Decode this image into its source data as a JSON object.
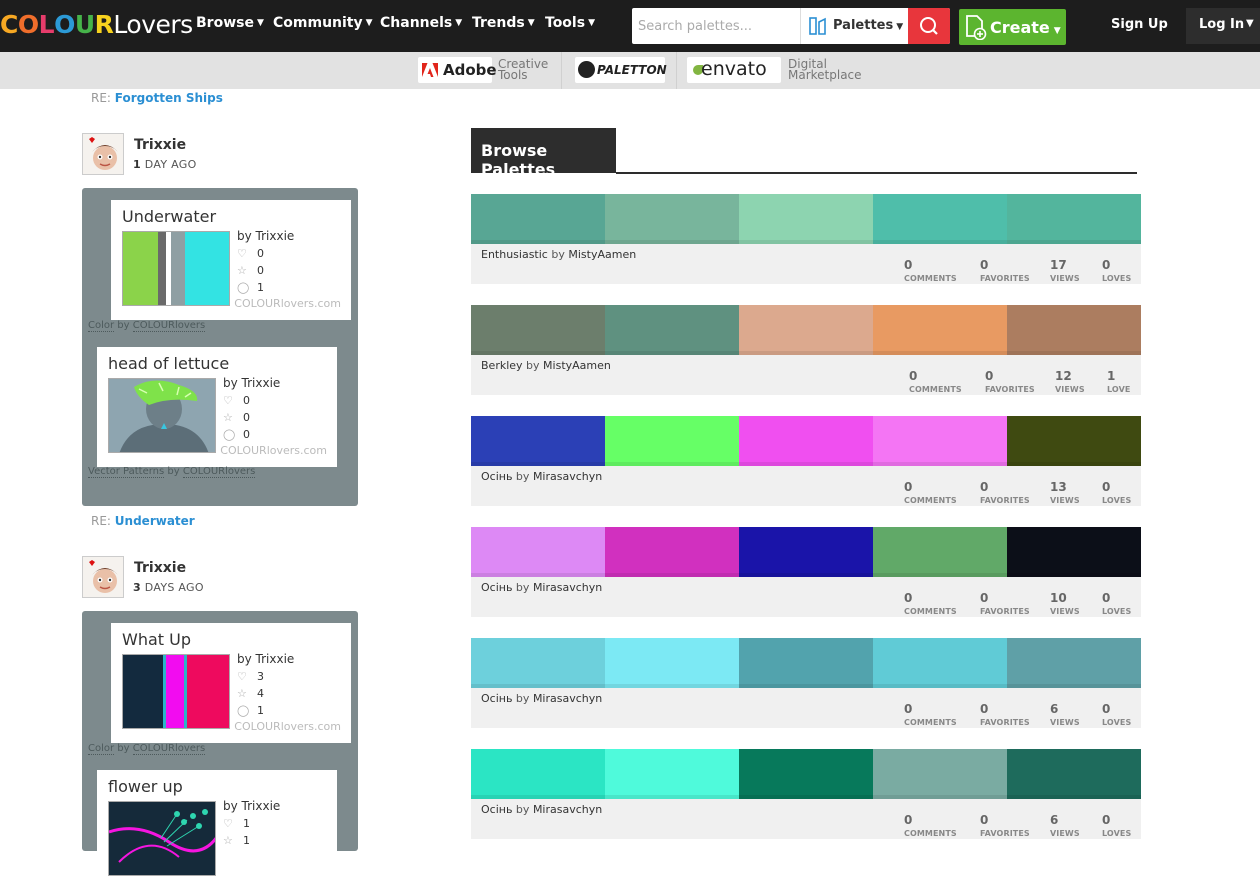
{
  "brand": {
    "letters": [
      "C",
      "O",
      "L",
      "O",
      "U",
      "R"
    ],
    "letter_colors": [
      "#f7a823",
      "#f06e2b",
      "#e73c6b",
      "#2c9ad6",
      "#46b34a",
      "#f7d21e"
    ],
    "rest": "Lovers"
  },
  "nav": [
    "Browse",
    "Community",
    "Channels",
    "Trends",
    "Tools"
  ],
  "search": {
    "placeholder": "Search palettes...",
    "type_label": "Palettes"
  },
  "create_label": "Create",
  "signup_label": "Sign Up",
  "login_label": "Log In",
  "sponsors": [
    {
      "name": "Adobe",
      "caption": [
        "Creative",
        "Tools"
      ]
    },
    {
      "name": "PALETTON",
      "caption": []
    },
    {
      "name": "envato",
      "caption": [
        "Digital",
        "Marketplace"
      ]
    }
  ],
  "feed": {
    "re_prefix": "RE:",
    "re_top": "Forgotten Ships",
    "items": [
      {
        "user": "Trixxie",
        "ago_num": "1",
        "ago_text": " DAY AGO",
        "cards": [
          {
            "title": "Underwater",
            "by_prefix": "by ",
            "by": "Trixxie",
            "stats": [
              "0",
              "0",
              "1"
            ],
            "site": "COLOURlovers.com",
            "caption_kind": "Color",
            "caption_by": "by",
            "caption_source": "COLOURlovers",
            "colors": [
              "#8bd34a",
              "#6a6a6a",
              "#8f9fa3",
              "#33e3e3"
            ]
          },
          {
            "title": "head of lettuce",
            "by_prefix": "by ",
            "by": "Trixxie",
            "stats": [
              "0",
              "0",
              "0"
            ],
            "site": "COLOURlovers.com",
            "caption_kind": "Vector Patterns",
            "caption_by": "by",
            "caption_source": "COLOURlovers"
          }
        ],
        "re": "Underwater"
      },
      {
        "user": "Trixxie",
        "ago_num": "3",
        "ago_text": " DAYS AGO",
        "cards": [
          {
            "title": "What Up",
            "by_prefix": "by ",
            "by": "Trixxie",
            "stats": [
              "3",
              "4",
              "1"
            ],
            "site": "COLOURlovers.com",
            "caption_kind": "Color",
            "caption_by": "by",
            "caption_source": "COLOURlovers"
          },
          {
            "title": "flower up",
            "by_prefix": "by ",
            "by": "Trixxie",
            "stats": [
              "1",
              "1"
            ]
          }
        ]
      }
    ]
  },
  "browse": {
    "title": "Browse Palettes",
    "stat_labels": {
      "comments": "COMMENTS",
      "favorites": "FAVORITES",
      "views": "VIEWS",
      "loves": "LOVES",
      "love": "LOVE"
    },
    "palettes": [
      {
        "name": "Enthusiastic",
        "by": "by",
        "author": "MistyAamen",
        "colors": [
          "#58a694",
          "#78b59c",
          "#8dd4b0",
          "#4fbeaa",
          "#53b59d"
        ],
        "comments": "0",
        "favorites": "0",
        "views": "17",
        "loves": "0",
        "loves_label": "LOVES"
      },
      {
        "name": "Berkley",
        "by": "by",
        "author": "MistyAamen",
        "colors": [
          "#6c7e6c",
          "#5f9180",
          "#dca98e",
          "#e89a62",
          "#ac7d60"
        ],
        "comments": "0",
        "favorites": "0",
        "views": "12",
        "loves": "1",
        "loves_label": "LOVE"
      },
      {
        "name": "Осінь",
        "by": "by",
        "author": "Mirasavchyn",
        "colors": [
          "#2b40b6",
          "#66ff66",
          "#f04ff0",
          "#f475f4",
          "#3f4a11"
        ],
        "comments": "0",
        "favorites": "0",
        "views": "13",
        "loves": "0",
        "loves_label": "LOVES"
      },
      {
        "name": "Осінь",
        "by": "by",
        "author": "Mirasavchyn",
        "colors": [
          "#dd89f5",
          "#d130bf",
          "#1a14a9",
          "#61a968",
          "#0c0f18"
        ],
        "comments": "0",
        "favorites": "0",
        "views": "10",
        "loves": "0",
        "loves_label": "LOVES"
      },
      {
        "name": "Осінь",
        "by": "by",
        "author": "Mirasavchyn",
        "colors": [
          "#6dd0dc",
          "#7ce9f4",
          "#52a3ad",
          "#60cbd6",
          "#5fa0a7"
        ],
        "comments": "0",
        "favorites": "0",
        "views": "6",
        "loves": "0",
        "loves_label": "LOVES"
      },
      {
        "name": "Осінь",
        "by": "by",
        "author": "Mirasavchyn",
        "colors": [
          "#2be5c4",
          "#4ffadb",
          "#07795b",
          "#7aaba2",
          "#1e6b5c"
        ],
        "comments": "0",
        "favorites": "0",
        "views": "6",
        "loves": "0",
        "loves_label": "LOVES"
      }
    ]
  }
}
